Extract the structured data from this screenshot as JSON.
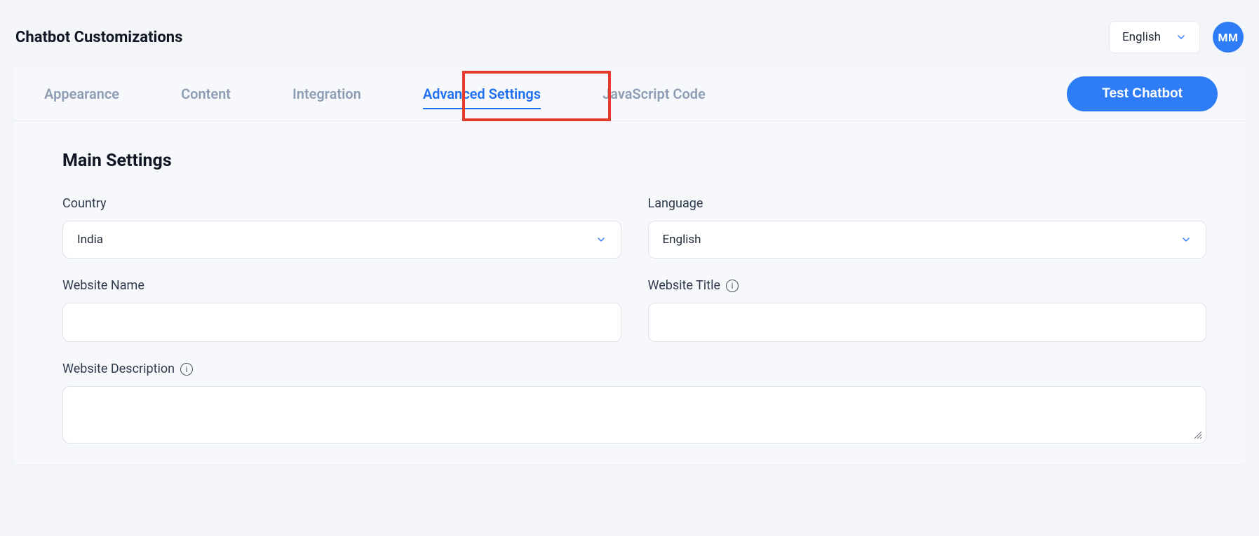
{
  "header": {
    "title": "Chatbot Customizations",
    "language_selected": "English",
    "avatar_initials": "MM"
  },
  "tabs": {
    "items": [
      {
        "label": "Appearance",
        "active": false
      },
      {
        "label": "Content",
        "active": false
      },
      {
        "label": "Integration",
        "active": false
      },
      {
        "label": "Advanced Settings",
        "active": true
      },
      {
        "label": "JavaScript Code",
        "active": false
      }
    ],
    "test_button_label": "Test Chatbot",
    "highlighted_tab_index": 3
  },
  "main": {
    "section_title": "Main Settings",
    "fields": {
      "country": {
        "label": "Country",
        "value": "India"
      },
      "language": {
        "label": "Language",
        "value": "English"
      },
      "website_name": {
        "label": "Website Name",
        "value": ""
      },
      "website_title": {
        "label": "Website Title",
        "value": "",
        "has_info": true
      },
      "website_description": {
        "label": "Website Description",
        "value": "",
        "has_info": true
      }
    }
  },
  "colors": {
    "primary": "#2e7df6",
    "highlight_border": "#e43b2d",
    "muted_text": "#8f9db4"
  }
}
